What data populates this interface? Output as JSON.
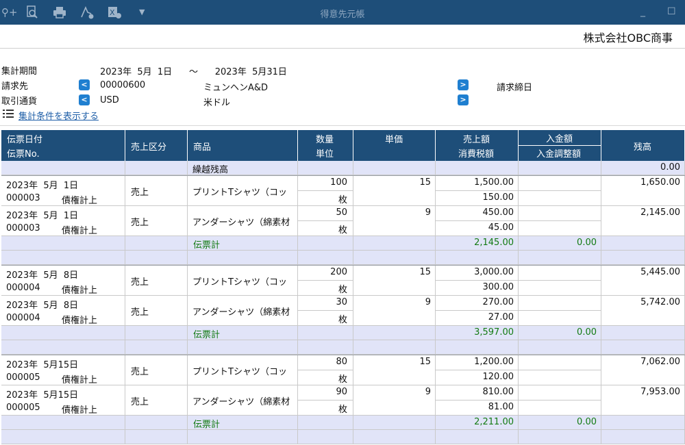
{
  "window": {
    "title": "得意先元帳"
  },
  "toolbar": {
    "icons": [
      "search-plus-icon",
      "magnifier-icon",
      "printer-icon",
      "pdf-icon",
      "excel-icon",
      "dropdown-icon"
    ]
  },
  "company": "株式会社OBC商事",
  "conditions": {
    "period_label": "集計期間",
    "period_value": "2023年  5月  1日      ～      2023年  5月31日",
    "customer_label": "請求先",
    "customer_code": "00000600",
    "customer_name": "ミュンヘンA&D",
    "closing_label": "請求締日",
    "currency_label": "取引通貨",
    "currency_code": "USD",
    "currency_name": "米ドル",
    "show_link": "集計条件を表示する"
  },
  "table": {
    "headers": {
      "date": "伝票日付",
      "slip": "伝票No.",
      "sales_type": "売上区分",
      "product": "商品",
      "qty": "数量",
      "unit": "単位",
      "price": "単価",
      "sales": "売上額",
      "tax": "消費税額",
      "payment": "入金額",
      "adjust": "入金調整額",
      "balance": "残高"
    },
    "carry": {
      "label": "繰越残高",
      "balance": "0.00"
    },
    "groups": [
      {
        "rows": [
          {
            "date": "2023年  5月  1日",
            "slip": "000003",
            "kind": "債権計上",
            "type": "売上",
            "product": "プリントTシャツ（コッ",
            "qty": "100",
            "unit": "枚",
            "price": "15",
            "sales": "1,500.00",
            "tax": "150.00",
            "balance": "1,650.00"
          },
          {
            "date": "2023年  5月  1日",
            "slip": "000003",
            "kind": "債権計上",
            "type": "売上",
            "product": "アンダーシャツ（綿素材",
            "qty": "50",
            "unit": "枚",
            "price": "9",
            "sales": "450.00",
            "tax": "45.00",
            "balance": "2,145.00"
          }
        ],
        "subtotal": {
          "label": "伝票計",
          "sales": "2,145.00",
          "payment": "0.00"
        }
      },
      {
        "rows": [
          {
            "date": "2023年  5月  8日",
            "slip": "000004",
            "kind": "債権計上",
            "type": "売上",
            "product": "プリントTシャツ（コッ",
            "qty": "200",
            "unit": "枚",
            "price": "15",
            "sales": "3,000.00",
            "tax": "300.00",
            "balance": "5,445.00"
          },
          {
            "date": "2023年  5月  8日",
            "slip": "000004",
            "kind": "債権計上",
            "type": "売上",
            "product": "アンダーシャツ（綿素材",
            "qty": "30",
            "unit": "枚",
            "price": "9",
            "sales": "270.00",
            "tax": "27.00",
            "balance": "5,742.00"
          }
        ],
        "subtotal": {
          "label": "伝票計",
          "sales": "3,597.00",
          "payment": "0.00"
        }
      },
      {
        "rows": [
          {
            "date": "2023年  5月15日",
            "slip": "000005",
            "kind": "債権計上",
            "type": "売上",
            "product": "プリントTシャツ（コッ",
            "qty": "80",
            "unit": "枚",
            "price": "15",
            "sales": "1,200.00",
            "tax": "120.00",
            "balance": "7,062.00"
          },
          {
            "date": "2023年  5月15日",
            "slip": "000005",
            "kind": "債権計上",
            "type": "売上",
            "product": "アンダーシャツ（綿素材",
            "qty": "90",
            "unit": "枚",
            "price": "9",
            "sales": "810.00",
            "tax": "81.00",
            "balance": "7,953.00"
          }
        ],
        "subtotal": {
          "label": "伝票計",
          "sales": "2,211.00",
          "payment": "0.00"
        }
      }
    ]
  }
}
